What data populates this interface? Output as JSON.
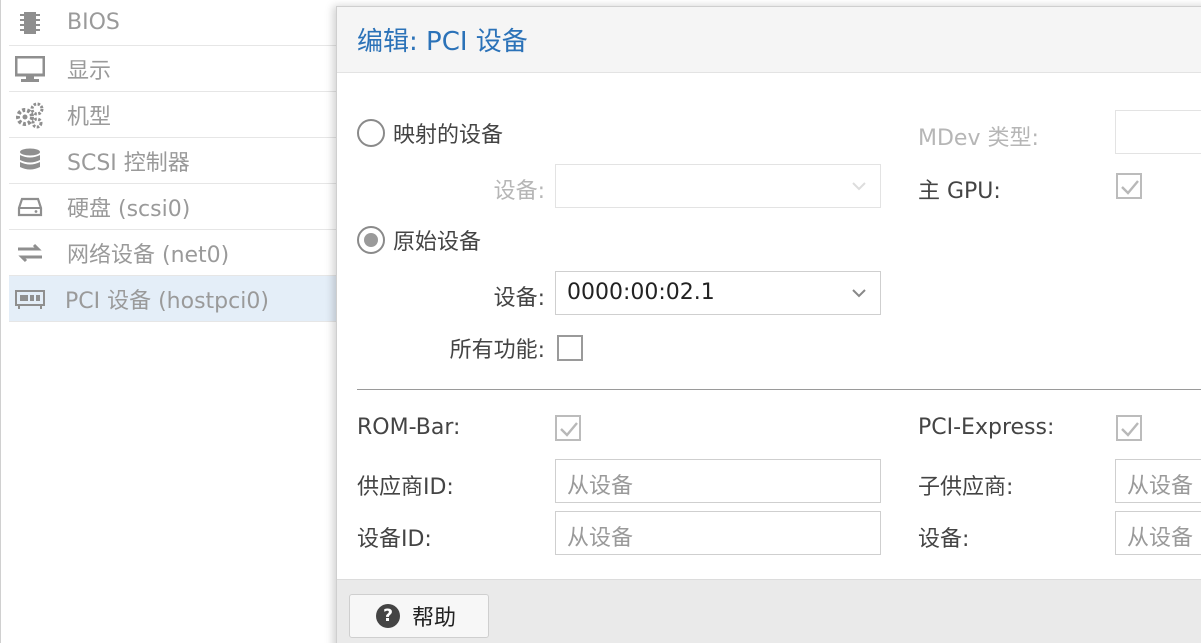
{
  "sidebar": {
    "items": [
      {
        "label": "BIOS",
        "icon": "chip-icon"
      },
      {
        "label": "显示",
        "icon": "monitor-icon"
      },
      {
        "label": "机型",
        "icon": "gears-icon"
      },
      {
        "label": "SCSI 控制器",
        "icon": "database-icon"
      },
      {
        "label": "硬盘 (scsi0)",
        "icon": "hdd-icon"
      },
      {
        "label": "网络设备 (net0)",
        "icon": "exchange-icon"
      },
      {
        "label": "PCI 设备 (hostpci0)",
        "icon": "pci-card-icon",
        "selected": true
      }
    ]
  },
  "dialog": {
    "title": "编辑: PCI 设备",
    "mapped_device_label": "映射的设备",
    "mapped_device_field_label": "设备:",
    "mapped_device_value": "",
    "raw_device_label": "原始设备",
    "raw_device_field_label": "设备:",
    "raw_device_value": "0000:00:02.1",
    "all_functions_label": "所有功能:",
    "mdev_type_label": "MDev 类型:",
    "mdev_type_value": "",
    "primary_gpu_label": "主 GPU:",
    "rom_bar_label": "ROM-Bar:",
    "pci_express_label": "PCI-Express:",
    "vendor_id_label": "供应商ID:",
    "vendor_id_placeholder": "从设备",
    "device_id_label": "设备ID:",
    "device_id_placeholder": "从设备",
    "sub_vendor_label": "子供应商:",
    "sub_vendor_placeholder": "从设备",
    "sub_device_label": "设备:",
    "sub_device_placeholder": "从设备",
    "help_label": "帮助"
  },
  "states": {
    "mapped_device_checked": false,
    "raw_device_checked": true,
    "all_functions_checked": false,
    "primary_gpu_checked": true,
    "rom_bar_checked": true,
    "pci_express_checked": true
  },
  "colors": {
    "title": "#2b72b8",
    "selected_row": "#e4eef8",
    "disabled_text": "#b6b6b6"
  }
}
